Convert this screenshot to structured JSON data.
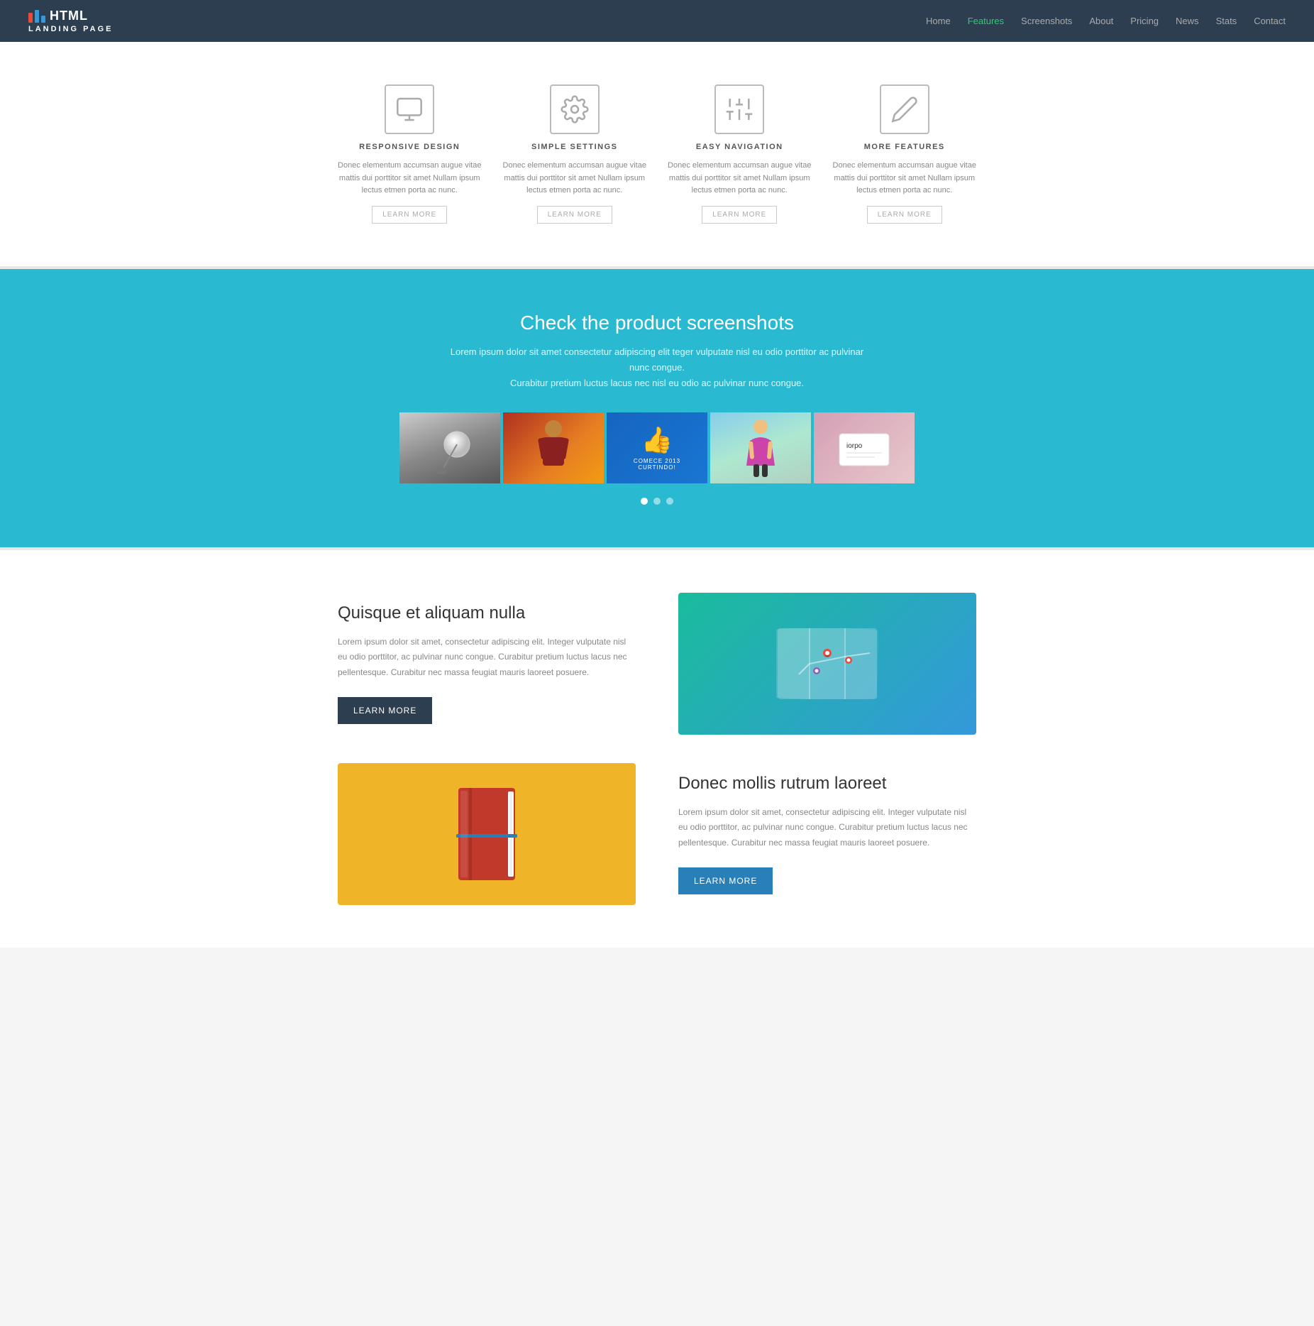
{
  "header": {
    "logo_text": "HTML",
    "logo_sub": "LANDING PAGE",
    "nav_items": [
      {
        "label": "Home",
        "active": false
      },
      {
        "label": "Features",
        "active": true
      },
      {
        "label": "Screenshots",
        "active": false
      },
      {
        "label": "About",
        "active": false
      },
      {
        "label": "Pricing",
        "active": false
      },
      {
        "label": "News",
        "active": false
      },
      {
        "label": "Stats",
        "active": false
      },
      {
        "label": "Contact",
        "active": false
      }
    ]
  },
  "features": {
    "items": [
      {
        "icon": "monitor",
        "title": "RESPONSIVE DESIGN",
        "desc": "Donec elementum accumsan augue vitae mattis dui porttitor sit amet Nullam ipsum lectus etmen porta ac nunc.",
        "btn": "LEARN MORE"
      },
      {
        "icon": "settings",
        "title": "SIMPLE SETTINGS",
        "desc": "Donec elementum accumsan augue vitae mattis dui porttitor sit amet Nullam ipsum lectus etmen porta ac nunc.",
        "btn": "LEARN MORE"
      },
      {
        "icon": "sliders",
        "title": "EASY NAVIGATION",
        "desc": "Donec elementum accumsan augue vitae mattis dui porttitor sit amet Nullam ipsum lectus etmen porta ac nunc.",
        "btn": "LEARN MORE"
      },
      {
        "icon": "pencil",
        "title": "MORE FEATURES",
        "desc": "Donec elementum accumsan augue vitae mattis dui porttitor sit amet Nullam ipsum lectus etmen porta ac nunc.",
        "btn": "LEARN MORE"
      }
    ]
  },
  "screenshots": {
    "title": "Check the product screenshots",
    "desc_line1": "Lorem ipsum dolor sit amet consectetur adipiscing elit teger vulputate nisl eu odio porttitor ac pulvinar nunc congue.",
    "desc_line2": "Curabitur pretium luctus lacus nec nisl eu odio ac pulvinar nunc congue."
  },
  "about": {
    "section1": {
      "title": "Quisque et aliquam nulla",
      "desc": "Lorem ipsum dolor sit amet, consectetur adipiscing elit. Integer vulputate nisl eu odio porttitor, ac pulvinar nunc congue. Curabitur pretium luctus lacus nec pellentesque. Curabitur nec massa feugiat mauris laoreet posuere.",
      "btn": "LEARN MORE"
    },
    "section2": {
      "title": "Donec mollis rutrum laoreet",
      "desc": "Lorem ipsum dolor sit amet, consectetur adipiscing elit. Integer vulputate nisl eu odio porttitor, ac pulvinar nunc congue. Curabitur pretium luctus lacus nec pellentesque. Curabitur nec massa feugiat mauris laoreet posuere.",
      "btn": "LEARN MORE"
    }
  }
}
